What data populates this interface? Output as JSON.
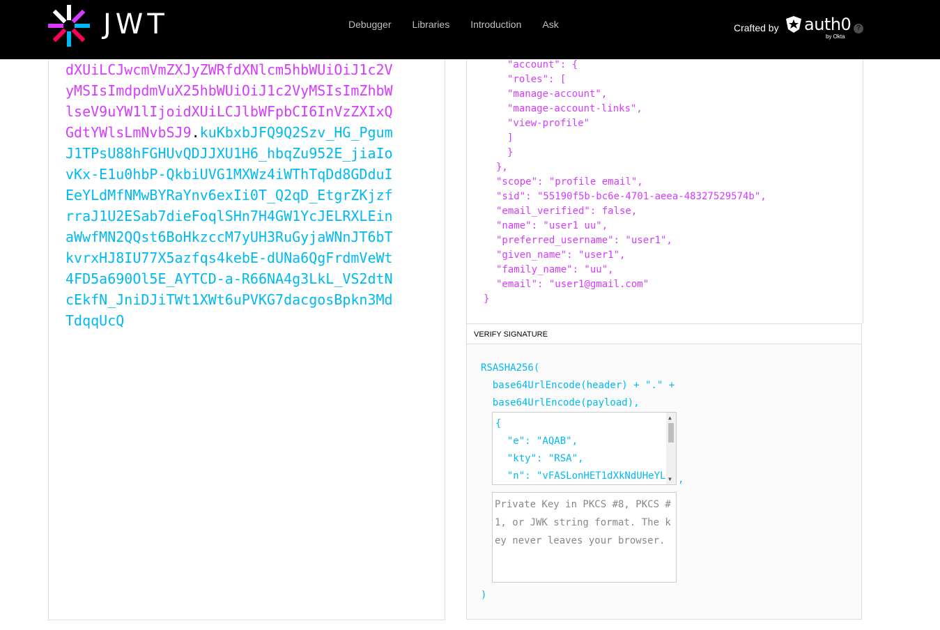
{
  "header": {
    "logo_text": "JWT",
    "nav": [
      "Debugger",
      "Libraries",
      "Introduction",
      "Ask"
    ],
    "crafted_by": "Crafted by",
    "brand": "auth0",
    "brand_sub": "by Okta",
    "help": "?"
  },
  "encoded": {
    "payload_part": "dXUiLCJwcmVmZXJyZWRfdXNlcm5hbWUiOiJ1c2VyMSIsImdpdmVuX25hbWUiOiJ1c2VyMSIsImZhbWlseV9uYW1lIjoidXUiLCJlbWFpbCI6InVzZXIxQGdtYWlsLmNvbSJ9",
    "dot": ".",
    "signature_part": "kuKbxbJFQ9Q2Szv_HG_PgumJ1TPsU88hFGHUvQDJJXU1H6_hbqZu952E_jiaIovKx-E1u0hbP-QkbiUVG1MXWz4iWThTqDd8GDduIEeYLdMfNMwBYRaYnv6exIi0T_Q2qD_EtgrZKjzfrraJ1U2ESab7dieFoqlSHn7H4GW1YcJELRXLEinaWwfMN2QQst6BoHkzccM7yUH3RuGyjaWNnJT6bTkvrxHJ8IU77X5azfqs4kebE-dUNa6QgFrdmVeWt4FD5a690Ol5E_AYTCD-a-R66NA4g3LkL_VS2dtNcEkfN_JniDJiTWt1XWt6uPVKG7dacgosBpkn3MdTdqqUcQ"
  },
  "payload_lines": [
    "    \"account\": {",
    "      \"roles\": [",
    "        \"manage-account\",",
    "        \"manage-account-links\",",
    "        \"view-profile\"",
    "      ]",
    "    }",
    "  },",
    "  \"scope\": \"profile email\",",
    "  \"sid\": \"55190f5b-bc6e-4701-aeea-48327529574b\",",
    "  \"email_verified\": false,",
    "  \"name\": \"user1 uu\",",
    "  \"preferred_username\": \"user1\",",
    "  \"given_name\": \"user1\",",
    "  \"family_name\": \"uu\",",
    "  \"email\": \"user1@gmail.com\"",
    "}"
  ],
  "verify": {
    "title": "VERIFY SIGNATURE",
    "line1": "RSASHA256(",
    "line2": "  base64UrlEncode(header) + \".\" +",
    "line3": "  base64UrlEncode(payload),",
    "public_key": "{\n  \"e\": \"AQAB\",\n  \"kty\": \"RSA\",\n  \"n\": \"vFASLonHET1dXkNdUHeYL",
    "comma": ",",
    "private_key_placeholder": "Private Key in PKCS #8, PKCS #1, or JWK string format. The key never leaves your browser.",
    "close": ")"
  }
}
